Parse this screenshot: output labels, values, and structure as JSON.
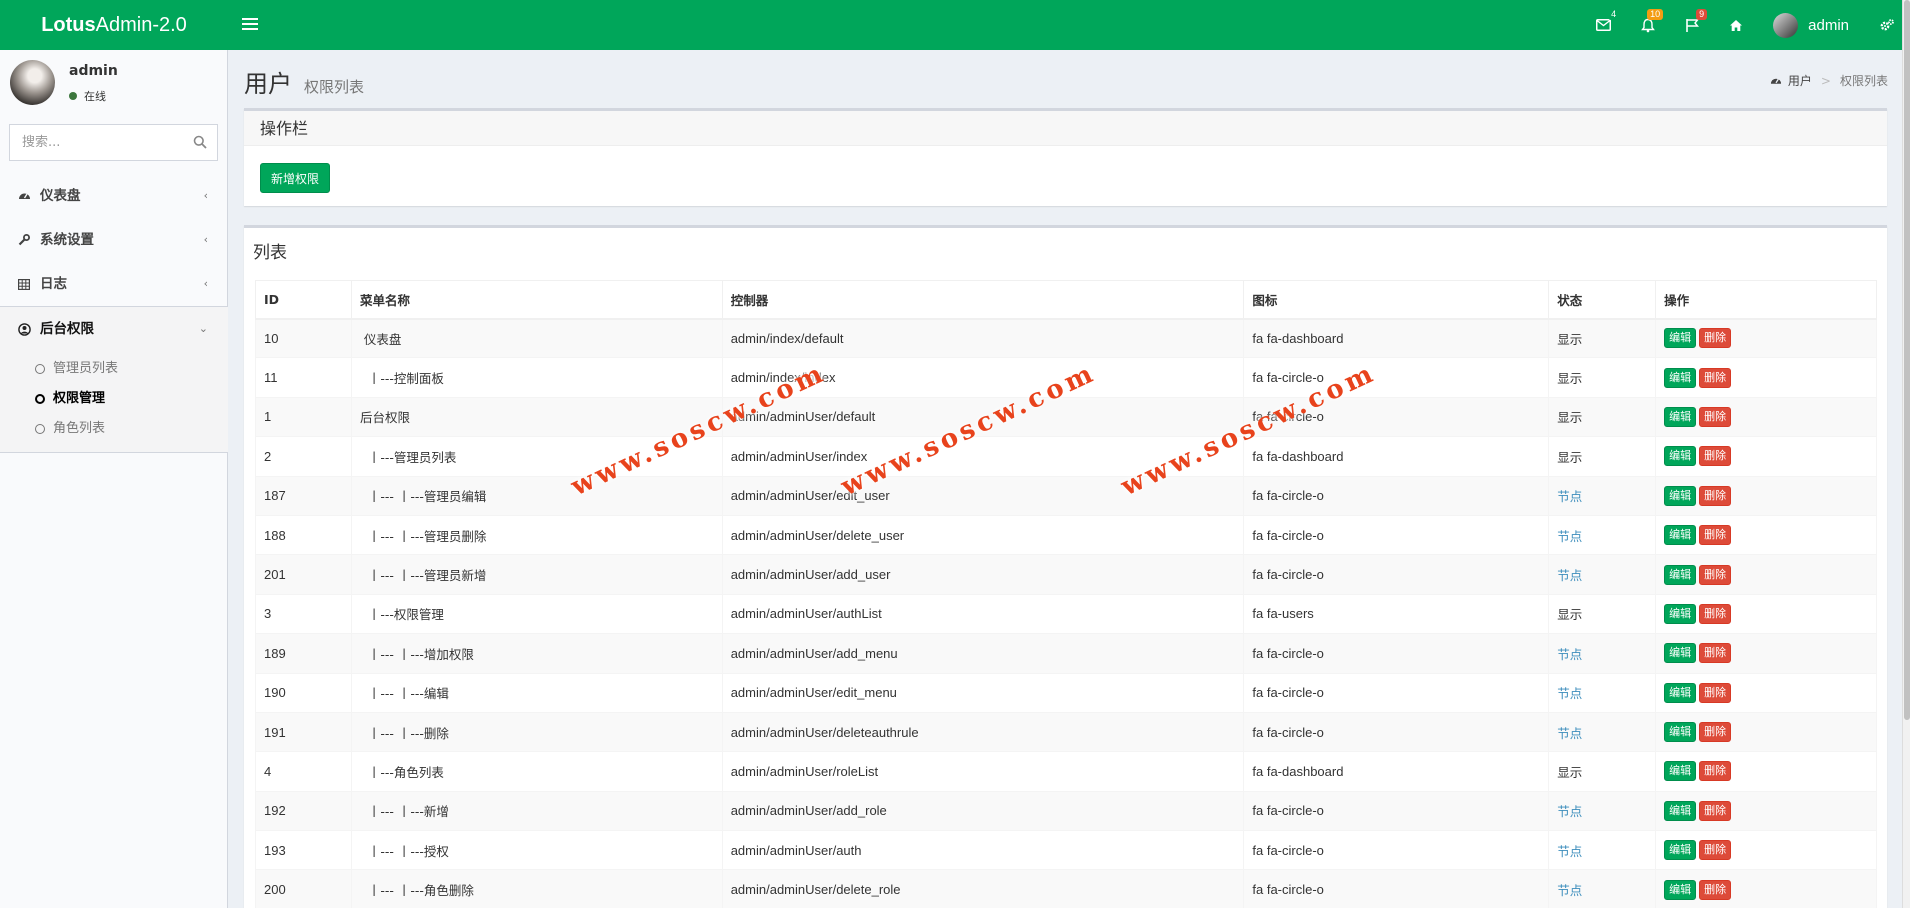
{
  "app": {
    "logo_bold": "Lotus",
    "logo_rest": "Admin-2.0"
  },
  "header": {
    "mail_badge": "4",
    "bell_badge": "10",
    "flag_badge": "9",
    "user_name": "admin"
  },
  "sidebar": {
    "user_name": "admin",
    "user_status": "在线",
    "search_placeholder": "搜索...",
    "menu": [
      {
        "label": "仪表盘",
        "icon": "dashboard-icon"
      },
      {
        "label": "系统设置",
        "icon": "wrench-icon"
      },
      {
        "label": "日志",
        "icon": "table-icon"
      },
      {
        "label": "后台权限",
        "icon": "user-circle-icon"
      }
    ],
    "submenu": [
      {
        "label": "管理员列表"
      },
      {
        "label": "权限管理"
      },
      {
        "label": "角色列表"
      }
    ]
  },
  "page": {
    "title": "用户",
    "subtitle": "权限列表",
    "breadcrumb": [
      "用户",
      "权限列表"
    ]
  },
  "ops_box": {
    "title": "操作栏",
    "add_button": "新增权限"
  },
  "list_box": {
    "title": "列表",
    "columns": [
      "ID",
      "菜单名称",
      "控制器",
      "图标",
      "状态",
      "操作"
    ],
    "edit_label": "编辑",
    "delete_label": "删除",
    "rows": [
      {
        "id": "10",
        "name": " 仪表盘",
        "controller": "admin/index/default",
        "icon": "fa fa-dashboard",
        "status": "显示",
        "status_type": "show"
      },
      {
        "id": "11",
        "name": "  丨---控制面板",
        "controller": "admin/index/index",
        "icon": "fa fa-circle-o",
        "status": "显示",
        "status_type": "show"
      },
      {
        "id": "1",
        "name": "后台权限",
        "controller": "admin/adminUser/default",
        "icon": "fa fa-circle-o",
        "status": "显示",
        "status_type": "show"
      },
      {
        "id": "2",
        "name": "  丨---管理员列表",
        "controller": "admin/adminUser/index",
        "icon": "fa fa-dashboard",
        "status": "显示",
        "status_type": "show"
      },
      {
        "id": "187",
        "name": "  丨--- 丨---管理员编辑",
        "controller": "admin/adminUser/edit_user",
        "icon": "fa fa-circle-o",
        "status": "节点",
        "status_type": "node"
      },
      {
        "id": "188",
        "name": "  丨--- 丨---管理员删除",
        "controller": "admin/adminUser/delete_user",
        "icon": "fa fa-circle-o",
        "status": "节点",
        "status_type": "node"
      },
      {
        "id": "201",
        "name": "  丨--- 丨---管理员新增",
        "controller": "admin/adminUser/add_user",
        "icon": "fa fa-circle-o",
        "status": "节点",
        "status_type": "node"
      },
      {
        "id": "3",
        "name": "  丨---权限管理",
        "controller": "admin/adminUser/authList",
        "icon": "fa fa-users",
        "status": "显示",
        "status_type": "show"
      },
      {
        "id": "189",
        "name": "  丨--- 丨---增加权限",
        "controller": "admin/adminUser/add_menu",
        "icon": "fa fa-circle-o",
        "status": "节点",
        "status_type": "node"
      },
      {
        "id": "190",
        "name": "  丨--- 丨---编辑",
        "controller": "admin/adminUser/edit_menu",
        "icon": "fa fa-circle-o",
        "status": "节点",
        "status_type": "node"
      },
      {
        "id": "191",
        "name": "  丨--- 丨---删除",
        "controller": "admin/adminUser/deleteauthrule",
        "icon": "fa fa-circle-o",
        "status": "节点",
        "status_type": "node"
      },
      {
        "id": "4",
        "name": "  丨---角色列表",
        "controller": "admin/adminUser/roleList",
        "icon": "fa fa-dashboard",
        "status": "显示",
        "status_type": "show"
      },
      {
        "id": "192",
        "name": "  丨--- 丨---新增",
        "controller": "admin/adminUser/add_role",
        "icon": "fa fa-circle-o",
        "status": "节点",
        "status_type": "node"
      },
      {
        "id": "193",
        "name": "  丨--- 丨---授权",
        "controller": "admin/adminUser/auth",
        "icon": "fa fa-circle-o",
        "status": "节点",
        "status_type": "node"
      },
      {
        "id": "200",
        "name": "  丨--- 丨---角色删除",
        "controller": "admin/adminUser/delete_role",
        "icon": "fa fa-circle-o",
        "status": "节点",
        "status_type": "node"
      }
    ]
  },
  "watermarks": [
    "www.soscw.com",
    "www.soscw.com",
    "www.soscw.com"
  ],
  "colors": {
    "brand": "#00a65a",
    "danger": "#dd4b39",
    "warning": "#f39c12",
    "link": "#3c8dbc"
  }
}
